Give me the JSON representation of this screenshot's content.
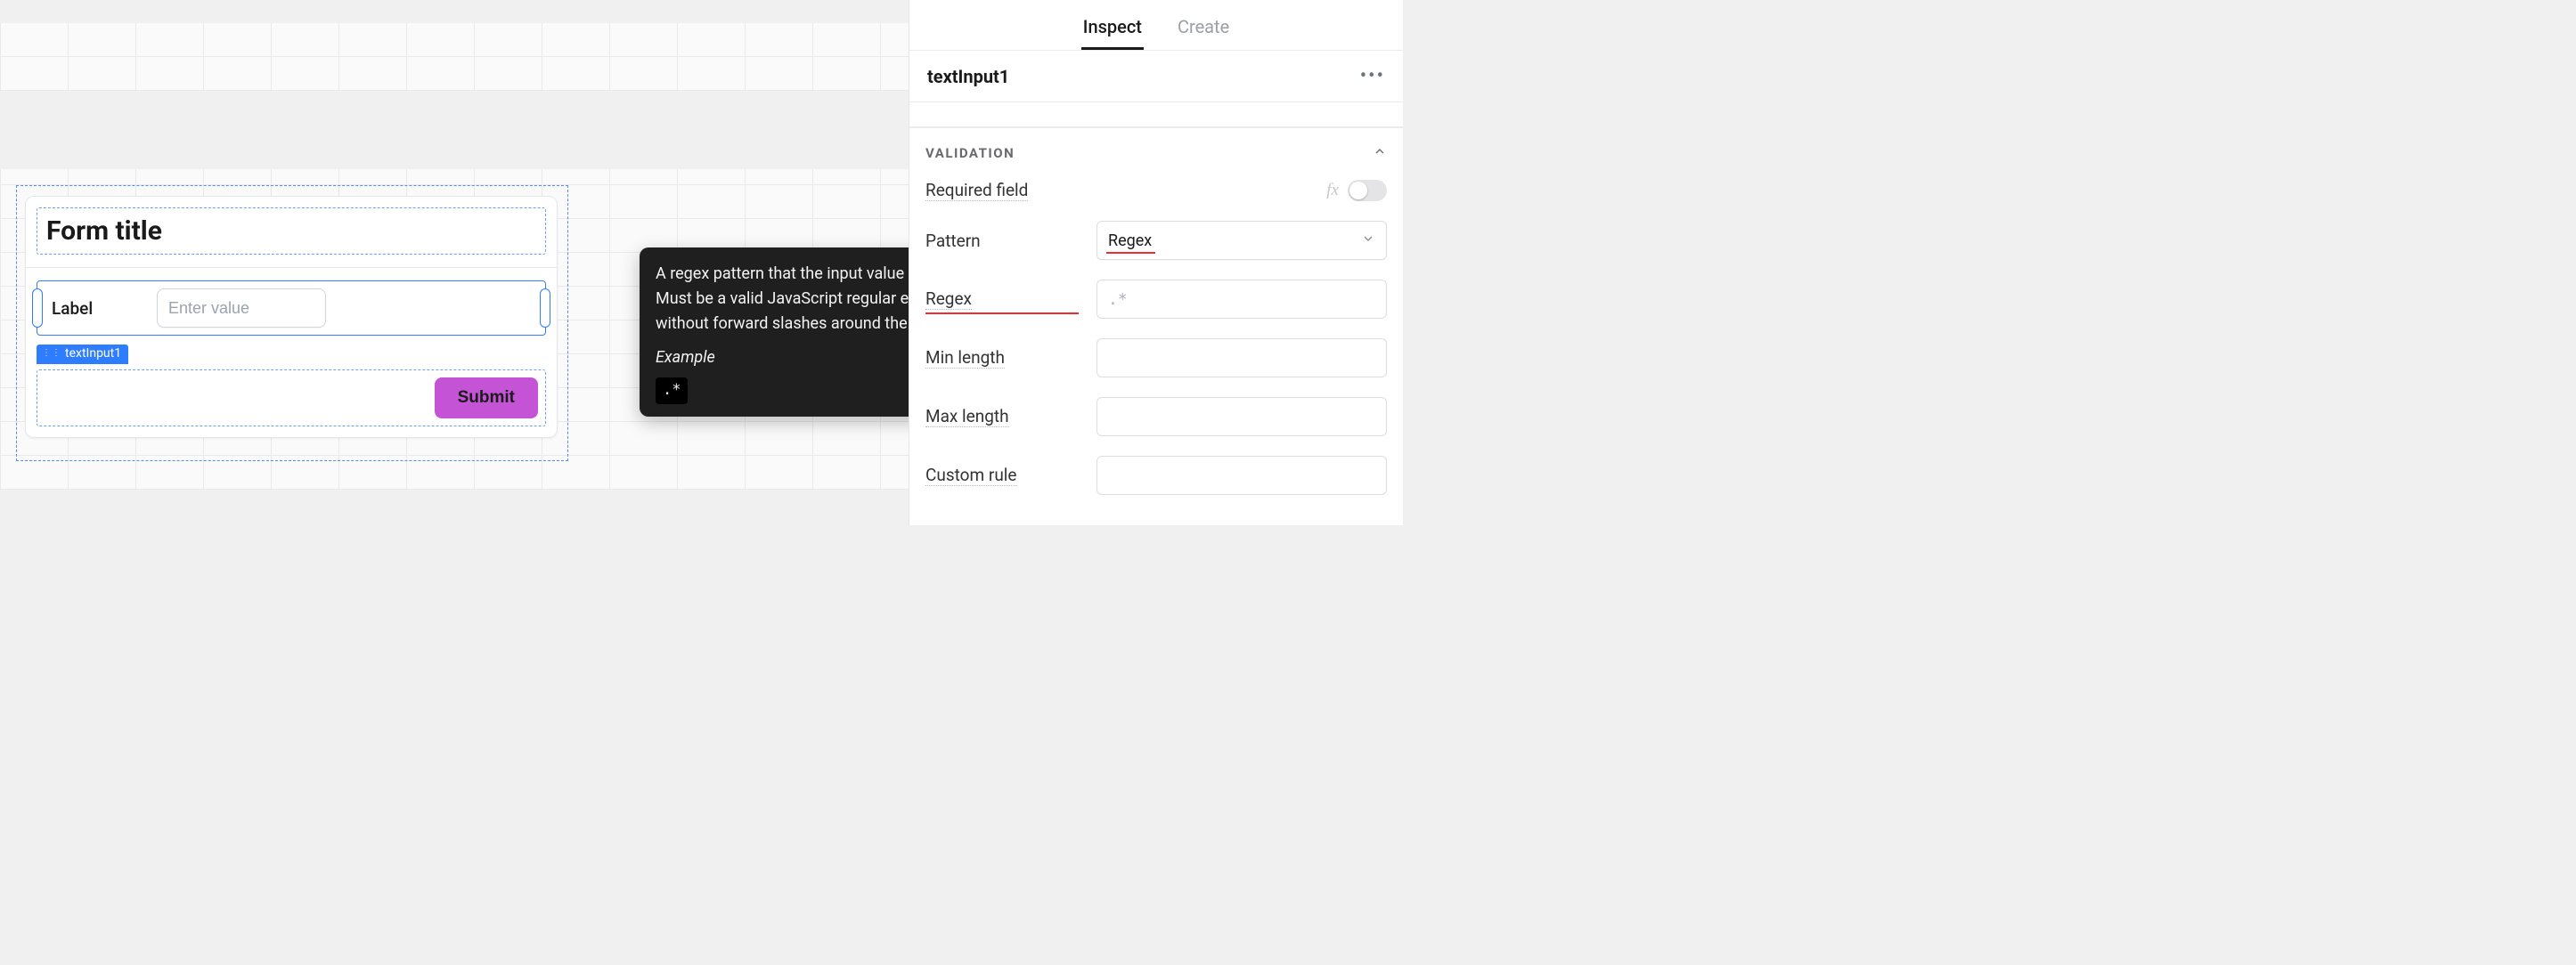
{
  "canvas": {
    "form": {
      "title": "Form title",
      "field": {
        "label": "Label",
        "placeholder": "Enter value"
      },
      "selected_component_chip": "textInput1",
      "submit_label": "Submit"
    }
  },
  "tooltip": {
    "body": "A regex pattern that the input value must match. Must be a valid JavaScript regular expression without forward slashes around the pattern.",
    "example_label": "Example",
    "example_code": ".*"
  },
  "panel": {
    "tabs": {
      "inspect": "Inspect",
      "create": "Create"
    },
    "component_name": "textInput1",
    "section_title": "VALIDATION",
    "props": {
      "required_field": {
        "label": "Required field",
        "fx": "fx",
        "toggle_on": false
      },
      "pattern": {
        "label": "Pattern",
        "value": "Regex"
      },
      "regex": {
        "label": "Regex",
        "placeholder": ".*"
      },
      "min_length": {
        "label": "Min length",
        "value": ""
      },
      "max_length": {
        "label": "Max length",
        "value": ""
      },
      "custom_rule": {
        "label": "Custom rule",
        "value": ""
      }
    }
  }
}
